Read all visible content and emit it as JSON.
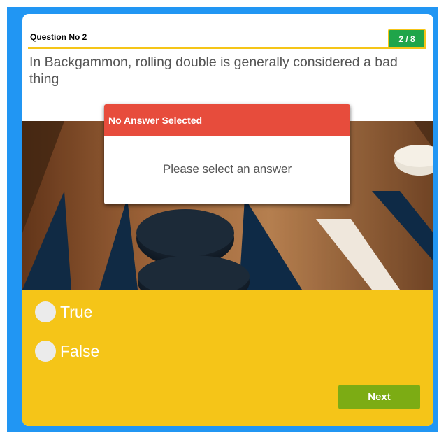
{
  "quiz": {
    "question_label": "Question No 2",
    "counter": "2 / 8",
    "question_text": "In Backgammon, rolling double is generally considered a bad thing",
    "image": "backgammon-board-photo",
    "options": [
      {
        "label": "True",
        "selected": false
      },
      {
        "label": "False",
        "selected": false
      }
    ],
    "next_label": "Next"
  },
  "modal": {
    "title": "No Answer Selected",
    "message": "Please select an answer"
  },
  "colors": {
    "frame": "#2196f3",
    "accent_yellow": "#f5c518",
    "counter_green": "#1fa54a",
    "next_green": "#7cac14",
    "modal_red": "#e74c3c"
  }
}
